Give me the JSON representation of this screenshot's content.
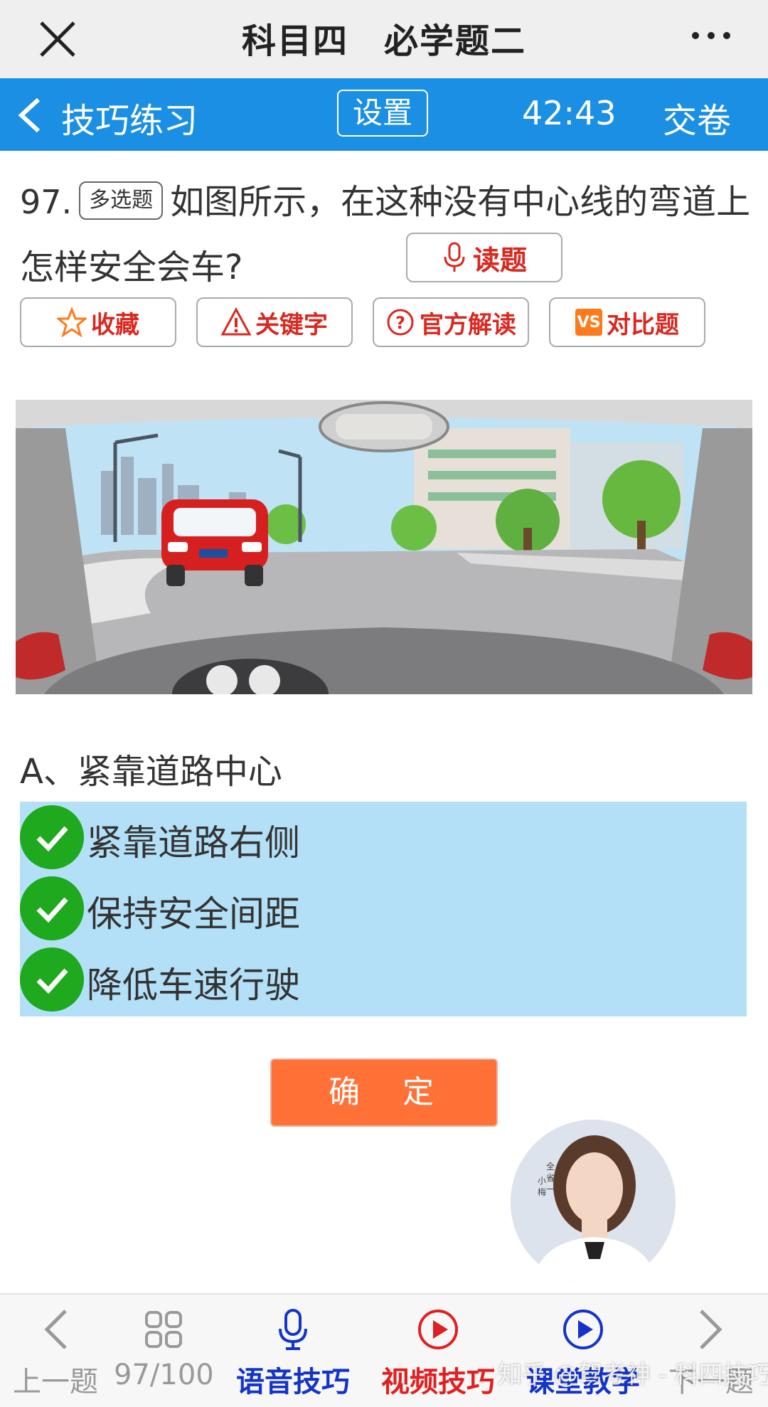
{
  "window": {
    "title": "科目四　必学题二"
  },
  "navbar": {
    "back_label": "技巧练习",
    "settings_label": "设置",
    "timer": "42:43",
    "submit_label": "交卷"
  },
  "question": {
    "number": "97.",
    "type_label": "多选题",
    "text": "如图所示，在这种没有中心线的弯道上怎样安全会车?",
    "read_label": "读题"
  },
  "tools": [
    {
      "label": "收藏",
      "icon": "star-icon"
    },
    {
      "label": "关键字",
      "icon": "warning-icon"
    },
    {
      "label": "官方解读",
      "icon": "question-icon"
    },
    {
      "label": "对比题",
      "icon": "vs-icon",
      "icon_text": "VS"
    }
  ],
  "options": {
    "a": "A、紧靠道路中心",
    "selected": [
      "紧靠道路右侧",
      "保持安全间距",
      "降低车速行驶"
    ]
  },
  "confirm_label": "确　定",
  "bottom_nav": [
    {
      "label": "上一题",
      "icon": "chevron-left-icon",
      "color": "#999999"
    },
    {
      "label": "97/100",
      "icon": "grid-icon",
      "color": "#999999"
    },
    {
      "label": "语音技巧",
      "icon": "microphone-icon",
      "color": "#1433c8"
    },
    {
      "label": "视频技巧",
      "icon": "play-icon",
      "color": "#e02020"
    },
    {
      "label": "课堂教学",
      "icon": "play-circle-icon",
      "color": "#1433c8"
    },
    {
      "label": "下一题",
      "icon": "chevron-right-icon",
      "color": "#999999"
    }
  ],
  "watermark": "知乎 @驾考神 - 科四技巧",
  "colors": {
    "nav_blue": "#1b8fe4",
    "answer_bg": "#b3e0f7",
    "check_green": "#1ea91e",
    "confirm_orange": "#ff7136",
    "accent_red": "#d9281f"
  }
}
